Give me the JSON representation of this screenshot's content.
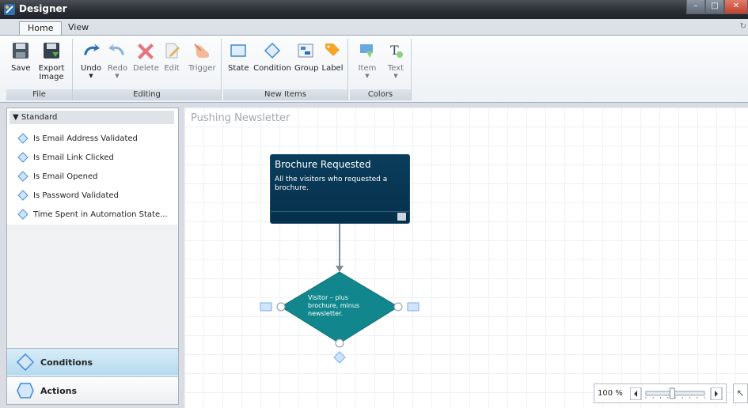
{
  "window": {
    "title": "Designer",
    "controls": [
      "minimize",
      "maximize",
      "close"
    ]
  },
  "tabs": [
    {
      "label": "Home",
      "active": true
    },
    {
      "label": "View",
      "active": false
    }
  ],
  "ribbon": {
    "file": {
      "label": "File",
      "save": "Save",
      "export_line1": "Export",
      "export_line2": "Image"
    },
    "editing": {
      "label": "Editing",
      "undo": "Undo",
      "redo": "Redo",
      "delete": "Delete",
      "edit": "Edit",
      "trigger": "Trigger"
    },
    "new_items": {
      "label": "New Items",
      "state": "State",
      "condition": "Condition",
      "group": "Group",
      "label_btn": "Label"
    },
    "colors": {
      "label": "Colors",
      "item": "Item",
      "text": "Text"
    }
  },
  "left_panel": {
    "category": "Standard",
    "items": [
      "Is Email Address Validated",
      "Is Email Link Clicked",
      "Is Email Opened",
      "Is Password Validated",
      "Time Spent in Automation State..."
    ],
    "nav": {
      "conditions": "Conditions",
      "actions": "Actions"
    }
  },
  "canvas": {
    "title": "Pushing Newsletter",
    "state": {
      "name": "Brochure Requested",
      "description": "All the visitors who requested a brochure."
    },
    "condition": {
      "text": "Visitor – plus brochure, minus newsletter."
    }
  },
  "zoom": {
    "level": "100 %",
    "fraction": 0.45
  },
  "colors": {
    "state_fill": "#06304b",
    "condition_fill": "#11878d",
    "accent": "#b6d9ee"
  }
}
